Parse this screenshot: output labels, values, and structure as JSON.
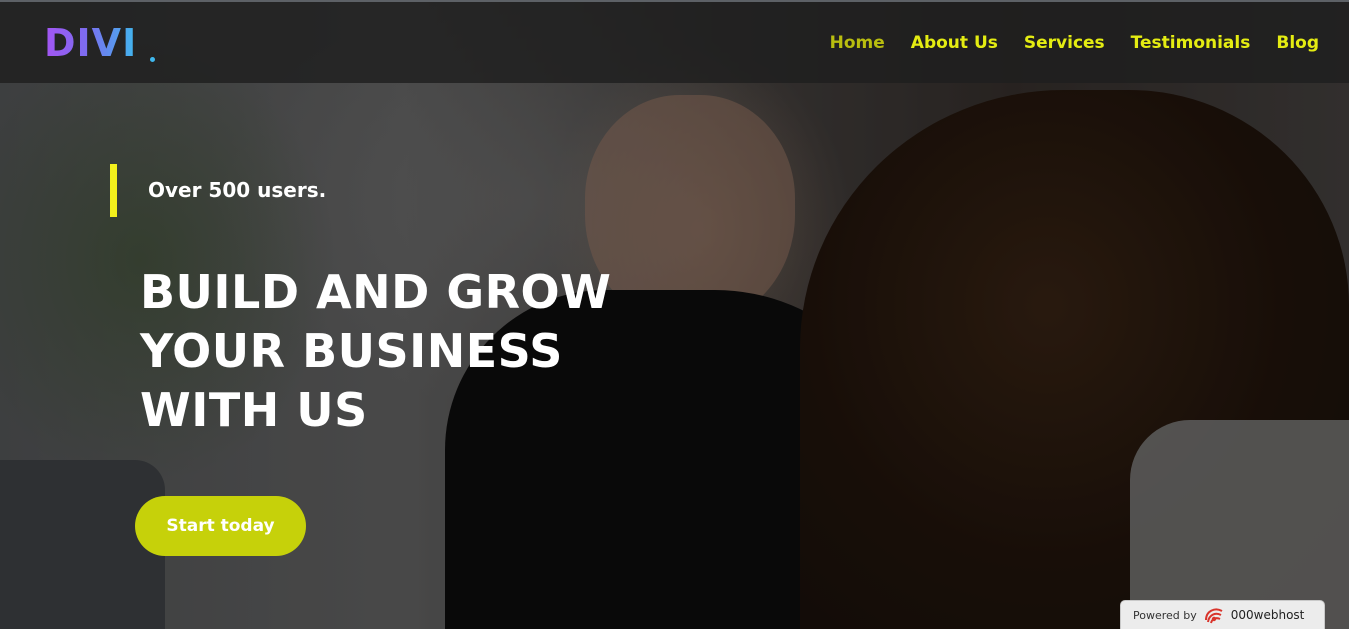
{
  "header": {
    "logo_text": "DIVI",
    "nav": [
      {
        "label": "Home",
        "active": true
      },
      {
        "label": "About Us",
        "active": false
      },
      {
        "label": "Services",
        "active": false
      },
      {
        "label": "Testimonials",
        "active": false
      },
      {
        "label": "Blog",
        "active": false
      }
    ]
  },
  "hero": {
    "badge": "Over 500 users.",
    "headline": [
      "BUILD AND GROW",
      "YOUR BUSINESS",
      "WITH US"
    ],
    "cta_label": "Start today"
  },
  "footer_badge": {
    "label": "Powered by",
    "brand": "000webhost"
  },
  "colors": {
    "nav_text": "#e4ec12",
    "nav_active": "#b9bd0f",
    "accent_bar": "#f3f01c",
    "cta_bg": "#c6d10a",
    "logo_gradient_start": "#a455f2",
    "logo_gradient_end": "#3fb8ee"
  },
  "icons": {
    "logo": "divi-logo",
    "brand_mark": "000webhost-swirl-icon"
  }
}
